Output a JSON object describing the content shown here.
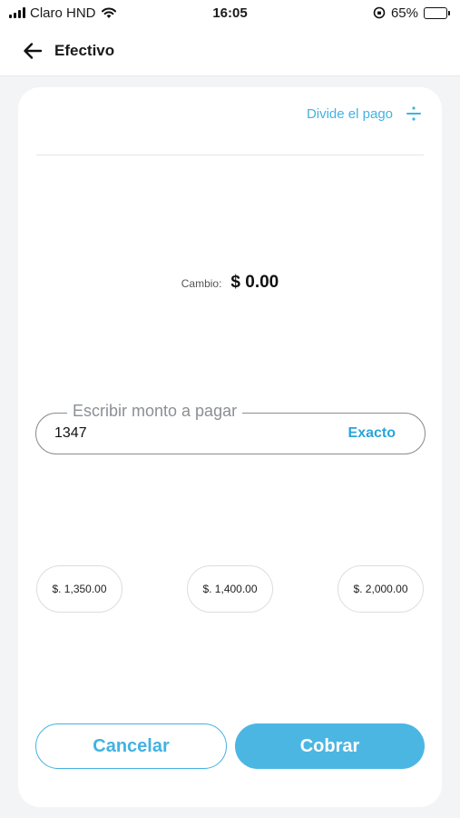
{
  "status_bar": {
    "carrier": "Claro HND",
    "time": "16:05",
    "battery_percent": "65%",
    "battery_level": 0.65,
    "icons": [
      "signal-icon",
      "wifi-icon",
      "orientation-lock-icon",
      "battery-icon"
    ]
  },
  "header": {
    "title": "Efectivo",
    "back_icon": "arrow-left-icon"
  },
  "split": {
    "label": "Divide el pago",
    "icon": "divide-icon"
  },
  "change": {
    "label": "Cambio:",
    "value": "$ 0.00"
  },
  "amount": {
    "label": "Escribir monto a pagar",
    "value": "1347",
    "exact_label": "Exacto"
  },
  "quick_amounts": [
    "$. 1,350.00",
    "$. 1,400.00",
    "$. 2,000.00"
  ],
  "actions": {
    "cancel_label": "Cancelar",
    "charge_label": "Cobrar"
  },
  "colors": {
    "accent": "#43b2e1",
    "primary_button": "#4cb6e3",
    "background": "#f3f4f6"
  }
}
